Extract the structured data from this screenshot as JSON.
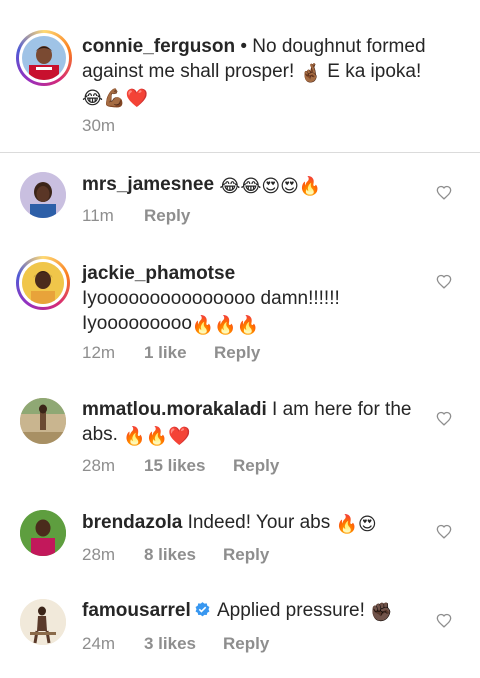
{
  "caption": {
    "username": "connie_ferguson",
    "text": " • No doughnut formed against me shall prosper! ",
    "text_tail": " E ka ipoka!",
    "emoji_1": "🤞🏾",
    "emoji_2": "😂💪🏾❤️",
    "time": "30m"
  },
  "comments": [
    {
      "username": "mrs_jamesnee",
      "text": "",
      "emoji": "😂😂😍😍🔥",
      "time": "11m",
      "reply": "Reply"
    },
    {
      "username": "jackie_phamotse",
      "text_line1": "Iyooooooooooooooo damn!!!!!!",
      "text_line2": "Iyooooooooo",
      "emoji": "🔥🔥🔥",
      "time": "12m",
      "likes": "1 like",
      "reply": "Reply"
    },
    {
      "username": "mmatlou.morakaladi",
      "text": " I am here for the abs. ",
      "emoji": "🔥🔥❤️",
      "time": "28m",
      "likes": "15 likes",
      "reply": "Reply"
    },
    {
      "username": "brendazola",
      "text": " Indeed! Your abs ",
      "emoji": "🔥😍",
      "time": "28m",
      "likes": "8 likes",
      "reply": "Reply"
    },
    {
      "username": "famousarrel",
      "text": " Applied pressure! ",
      "emoji": "✊🏿",
      "time": "24m",
      "likes": "3 likes",
      "reply": "Reply"
    }
  ],
  "colors": {
    "story_ring_a": "#d6249f",
    "story_ring_b": "#fd5949",
    "verified": "#3897f0",
    "meta": "#8e8e8e",
    "divider": "#dbdbdb"
  },
  "icons": [
    "heart-icon",
    "verified-badge-icon"
  ]
}
